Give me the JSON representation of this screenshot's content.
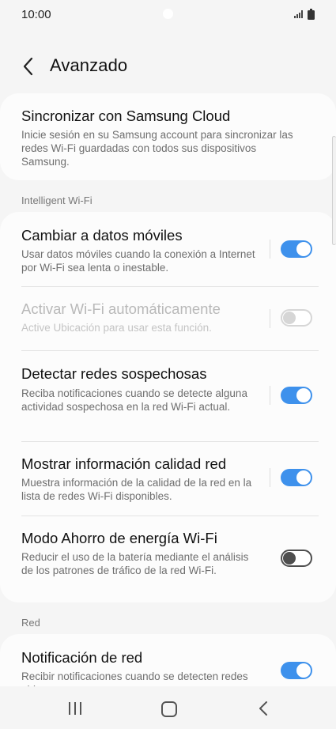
{
  "status_bar": {
    "time": "10:00"
  },
  "header": {
    "title": "Avanzado"
  },
  "cloud": {
    "title": "Sincronizar con Samsung Cloud",
    "desc": "Inicie sesión en su Samsung account para sincronizar las redes Wi-Fi guardadas con todos sus dispositivos Samsung."
  },
  "sections": {
    "intelligent": "Intelligent Wi-Fi",
    "red": "Red"
  },
  "items": [
    {
      "title": "Cambiar a datos móviles",
      "desc": "Usar datos móviles cuando la conexión a Internet por Wi-Fi sea lenta o inestable.",
      "state": "on"
    },
    {
      "title": "Activar Wi-Fi automáticamente",
      "desc": "Active Ubicación para usar esta función.",
      "state": "disabled"
    },
    {
      "title": "Detectar redes sospechosas",
      "desc": "Reciba notificaciones cuando se detecte alguna actividad sospechosa en la red Wi-Fi actual.",
      "state": "on"
    },
    {
      "title": "Mostrar información calidad red",
      "desc": "Muestra información de la calidad de la red en la lista de redes Wi-Fi disponibles.",
      "state": "on"
    },
    {
      "title": "Modo Ahorro de energía Wi-Fi",
      "desc": "Reducir el uso de la batería mediante el análisis de los patrones de tráfico de la red Wi-Fi.",
      "state": "off"
    }
  ],
  "notif": {
    "title": "Notificación de red",
    "desc": "Recibir notificaciones cuando se detecten redes abiertas cerca.",
    "state": "on"
  },
  "colors": {
    "accent": "#3e91ec",
    "background": "#f5f5f5",
    "card": "#fcfcfc"
  },
  "icons": {
    "back": "chevron-left-icon",
    "signal": "signal-icon",
    "battery": "battery-icon",
    "recents": "recents-icon",
    "home": "home-icon",
    "nav_back": "nav-back-icon"
  }
}
